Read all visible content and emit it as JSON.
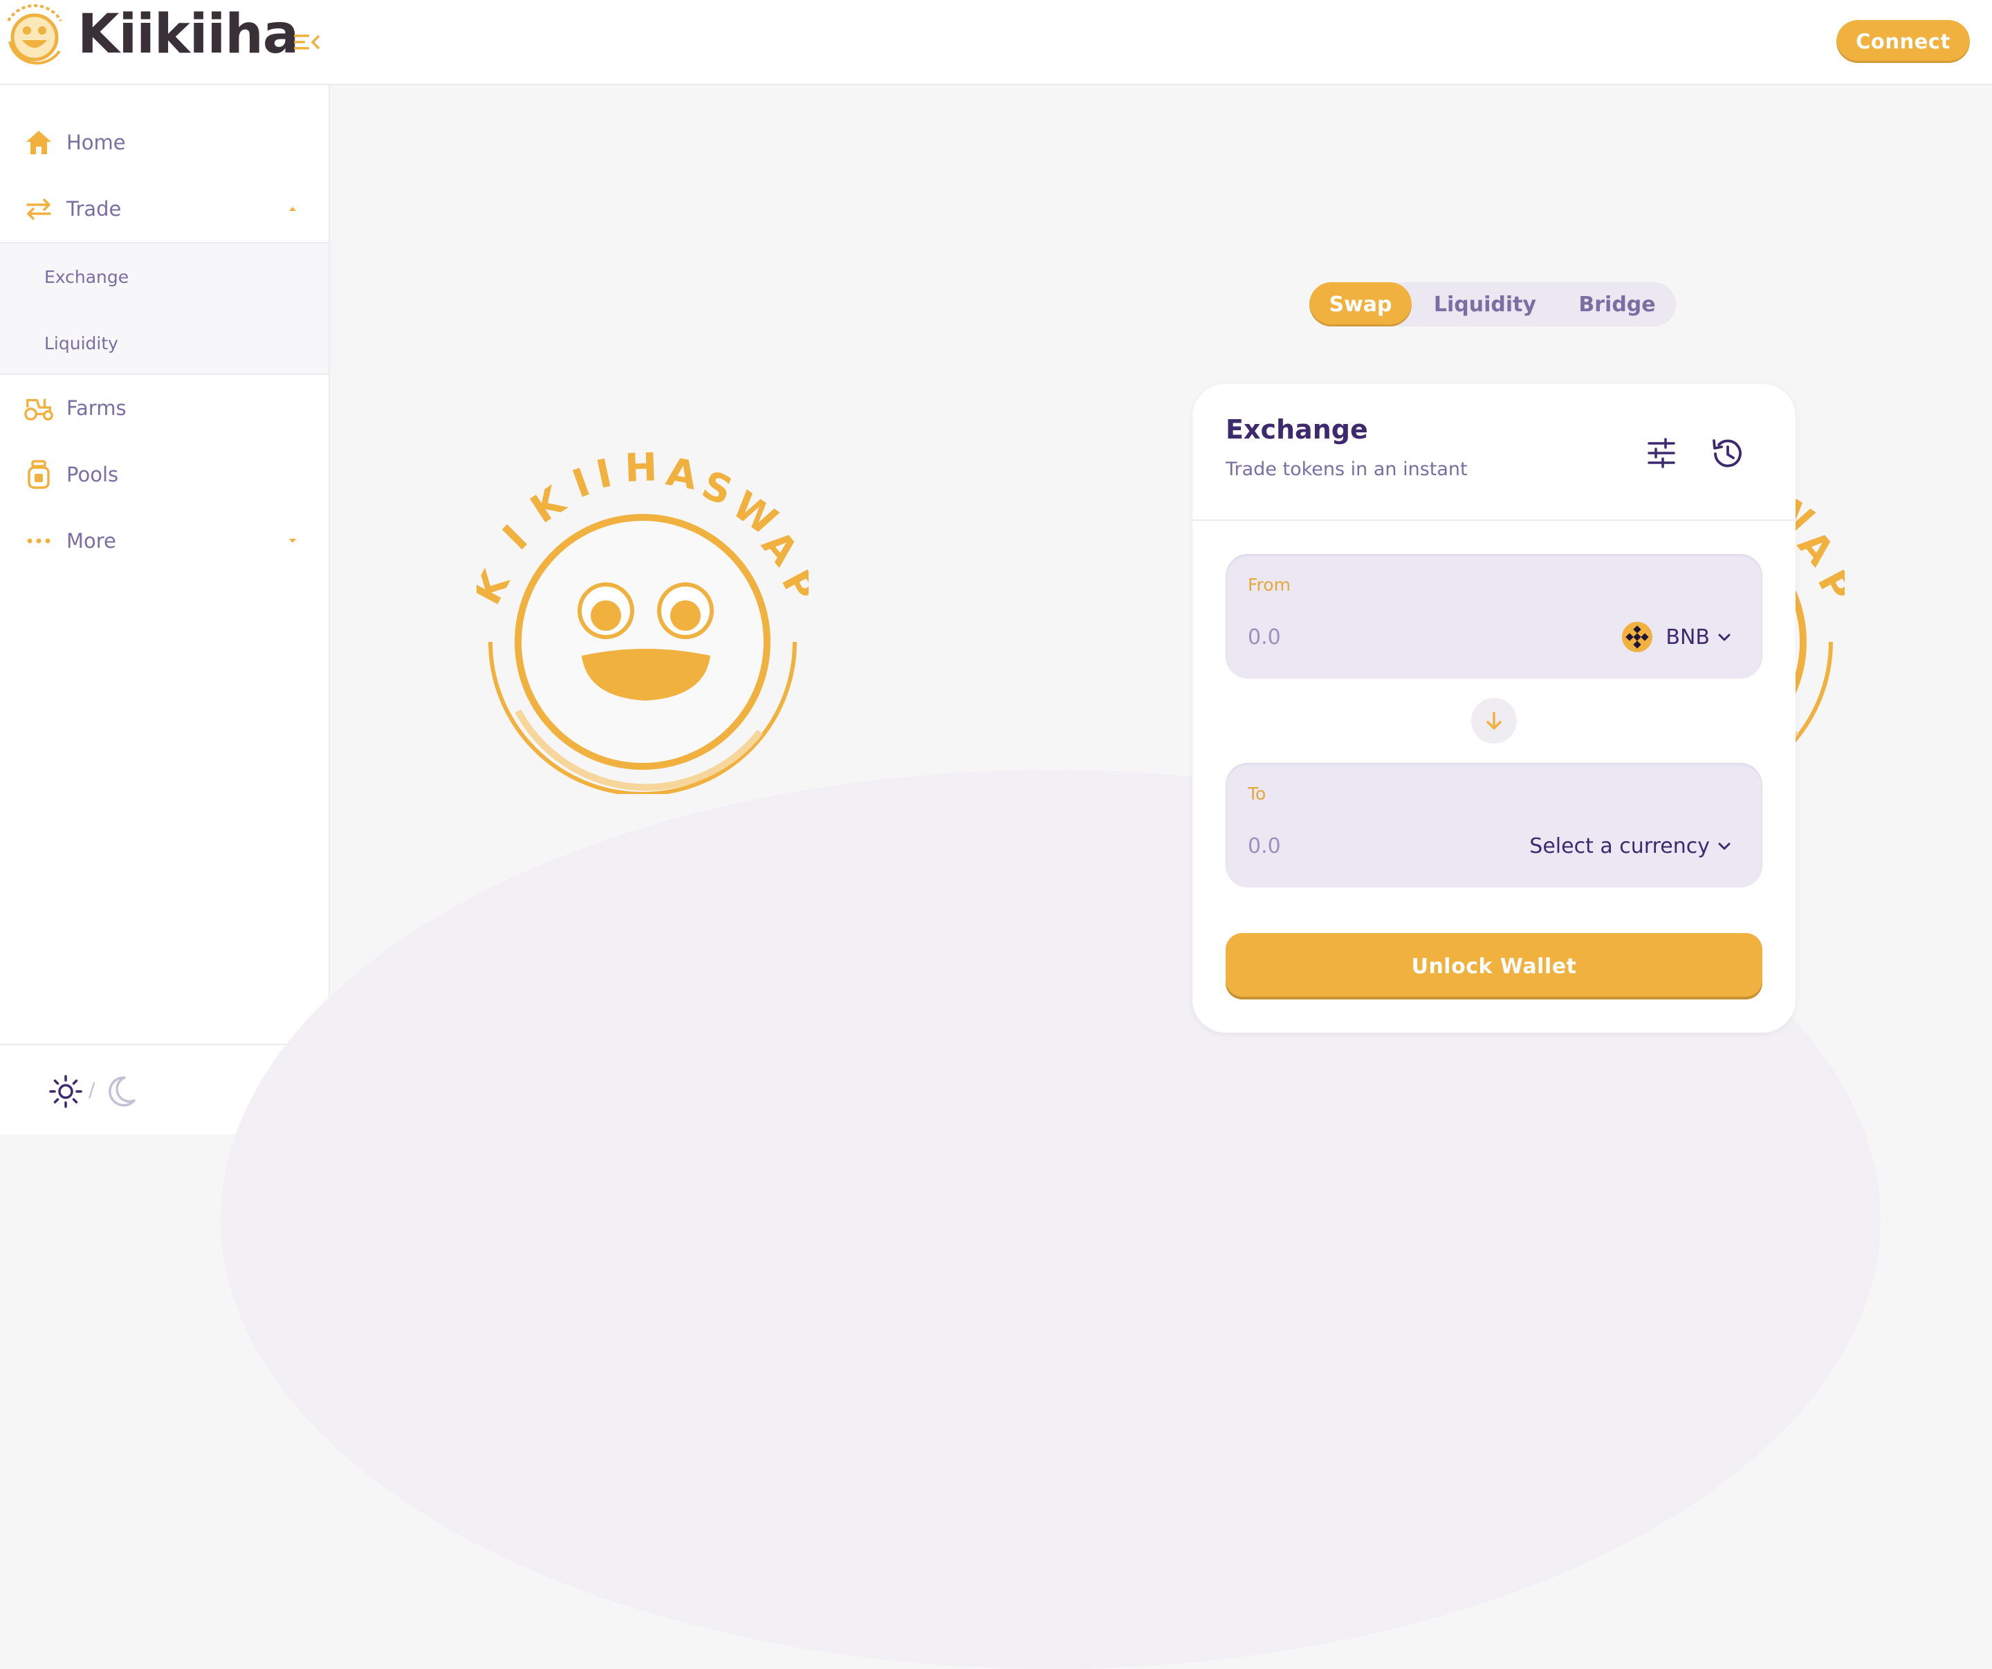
{
  "brand": {
    "name": "Kiikiiha"
  },
  "header": {
    "connect_label": "Connect"
  },
  "sidebar": {
    "items": [
      {
        "label": "Home"
      },
      {
        "label": "Trade"
      },
      {
        "label": "Farms"
      },
      {
        "label": "Pools"
      },
      {
        "label": "More"
      }
    ],
    "trade_sub": [
      {
        "label": "Exchange"
      },
      {
        "label": "Liquidity"
      }
    ],
    "theme_separator": "/"
  },
  "tabs": [
    {
      "label": "Swap",
      "active": true
    },
    {
      "label": "Liquidity",
      "active": false
    },
    {
      "label": "Bridge",
      "active": false
    }
  ],
  "exchange": {
    "title": "Exchange",
    "subtitle": "Trade tokens in an instant",
    "from": {
      "label": "From",
      "placeholder": "0.0",
      "currency": "BNB"
    },
    "to": {
      "label": "To",
      "placeholder": "0.0",
      "currency": "Select a currency"
    },
    "unlock_label": "Unlock Wallet"
  },
  "colors": {
    "accent": "#f1b13f",
    "text_primary": "#3d2a6e",
    "text_secondary": "#7a6ea3",
    "panel_bg": "#ebe7f3"
  },
  "icons": {
    "menu_toggle": "menu-collapse-icon",
    "home": "home-icon",
    "trade": "swap-arrows-icon",
    "farms": "tractor-icon",
    "pools": "jar-icon",
    "more": "dots-icon",
    "settings": "sliders-icon",
    "history": "history-icon",
    "switch": "arrow-down-icon",
    "bnb": "bnb-token-icon",
    "theme_light": "sun-icon",
    "theme_dark": "moon-icon"
  }
}
